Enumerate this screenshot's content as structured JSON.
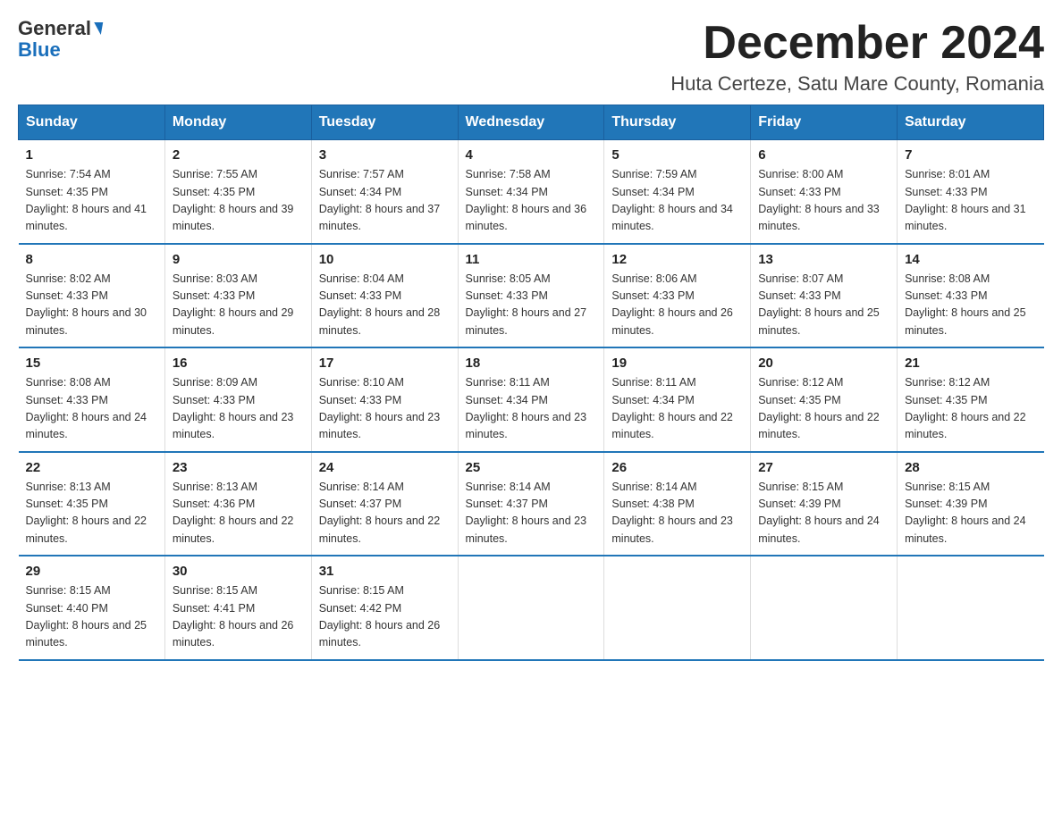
{
  "header": {
    "logo_general": "General",
    "logo_blue": "Blue",
    "month_title": "December 2024",
    "location": "Huta Certeze, Satu Mare County, Romania"
  },
  "days_of_week": [
    "Sunday",
    "Monday",
    "Tuesday",
    "Wednesday",
    "Thursday",
    "Friday",
    "Saturday"
  ],
  "weeks": [
    [
      {
        "num": "1",
        "sunrise": "7:54 AM",
        "sunset": "4:35 PM",
        "daylight": "8 hours and 41 minutes."
      },
      {
        "num": "2",
        "sunrise": "7:55 AM",
        "sunset": "4:35 PM",
        "daylight": "8 hours and 39 minutes."
      },
      {
        "num": "3",
        "sunrise": "7:57 AM",
        "sunset": "4:34 PM",
        "daylight": "8 hours and 37 minutes."
      },
      {
        "num": "4",
        "sunrise": "7:58 AM",
        "sunset": "4:34 PM",
        "daylight": "8 hours and 36 minutes."
      },
      {
        "num": "5",
        "sunrise": "7:59 AM",
        "sunset": "4:34 PM",
        "daylight": "8 hours and 34 minutes."
      },
      {
        "num": "6",
        "sunrise": "8:00 AM",
        "sunset": "4:33 PM",
        "daylight": "8 hours and 33 minutes."
      },
      {
        "num": "7",
        "sunrise": "8:01 AM",
        "sunset": "4:33 PM",
        "daylight": "8 hours and 31 minutes."
      }
    ],
    [
      {
        "num": "8",
        "sunrise": "8:02 AM",
        "sunset": "4:33 PM",
        "daylight": "8 hours and 30 minutes."
      },
      {
        "num": "9",
        "sunrise": "8:03 AM",
        "sunset": "4:33 PM",
        "daylight": "8 hours and 29 minutes."
      },
      {
        "num": "10",
        "sunrise": "8:04 AM",
        "sunset": "4:33 PM",
        "daylight": "8 hours and 28 minutes."
      },
      {
        "num": "11",
        "sunrise": "8:05 AM",
        "sunset": "4:33 PM",
        "daylight": "8 hours and 27 minutes."
      },
      {
        "num": "12",
        "sunrise": "8:06 AM",
        "sunset": "4:33 PM",
        "daylight": "8 hours and 26 minutes."
      },
      {
        "num": "13",
        "sunrise": "8:07 AM",
        "sunset": "4:33 PM",
        "daylight": "8 hours and 25 minutes."
      },
      {
        "num": "14",
        "sunrise": "8:08 AM",
        "sunset": "4:33 PM",
        "daylight": "8 hours and 25 minutes."
      }
    ],
    [
      {
        "num": "15",
        "sunrise": "8:08 AM",
        "sunset": "4:33 PM",
        "daylight": "8 hours and 24 minutes."
      },
      {
        "num": "16",
        "sunrise": "8:09 AM",
        "sunset": "4:33 PM",
        "daylight": "8 hours and 23 minutes."
      },
      {
        "num": "17",
        "sunrise": "8:10 AM",
        "sunset": "4:33 PM",
        "daylight": "8 hours and 23 minutes."
      },
      {
        "num": "18",
        "sunrise": "8:11 AM",
        "sunset": "4:34 PM",
        "daylight": "8 hours and 23 minutes."
      },
      {
        "num": "19",
        "sunrise": "8:11 AM",
        "sunset": "4:34 PM",
        "daylight": "8 hours and 22 minutes."
      },
      {
        "num": "20",
        "sunrise": "8:12 AM",
        "sunset": "4:35 PM",
        "daylight": "8 hours and 22 minutes."
      },
      {
        "num": "21",
        "sunrise": "8:12 AM",
        "sunset": "4:35 PM",
        "daylight": "8 hours and 22 minutes."
      }
    ],
    [
      {
        "num": "22",
        "sunrise": "8:13 AM",
        "sunset": "4:35 PM",
        "daylight": "8 hours and 22 minutes."
      },
      {
        "num": "23",
        "sunrise": "8:13 AM",
        "sunset": "4:36 PM",
        "daylight": "8 hours and 22 minutes."
      },
      {
        "num": "24",
        "sunrise": "8:14 AM",
        "sunset": "4:37 PM",
        "daylight": "8 hours and 22 minutes."
      },
      {
        "num": "25",
        "sunrise": "8:14 AM",
        "sunset": "4:37 PM",
        "daylight": "8 hours and 23 minutes."
      },
      {
        "num": "26",
        "sunrise": "8:14 AM",
        "sunset": "4:38 PM",
        "daylight": "8 hours and 23 minutes."
      },
      {
        "num": "27",
        "sunrise": "8:15 AM",
        "sunset": "4:39 PM",
        "daylight": "8 hours and 24 minutes."
      },
      {
        "num": "28",
        "sunrise": "8:15 AM",
        "sunset": "4:39 PM",
        "daylight": "8 hours and 24 minutes."
      }
    ],
    [
      {
        "num": "29",
        "sunrise": "8:15 AM",
        "sunset": "4:40 PM",
        "daylight": "8 hours and 25 minutes."
      },
      {
        "num": "30",
        "sunrise": "8:15 AM",
        "sunset": "4:41 PM",
        "daylight": "8 hours and 26 minutes."
      },
      {
        "num": "31",
        "sunrise": "8:15 AM",
        "sunset": "4:42 PM",
        "daylight": "8 hours and 26 minutes."
      },
      null,
      null,
      null,
      null
    ]
  ]
}
